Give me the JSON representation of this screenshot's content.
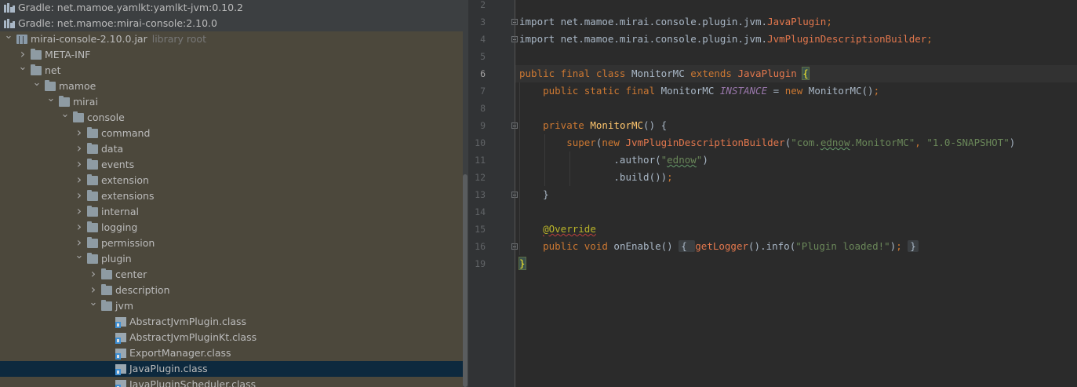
{
  "project_tree": {
    "rows": [
      {
        "label": "Gradle: net.mamoe.yamlkt:yamlkt-jvm:0.10.2",
        "kind": "library",
        "depth": 0,
        "arrow": ""
      },
      {
        "label": "Gradle: net.mamoe:mirai-console:2.10.0",
        "kind": "library",
        "depth": 0,
        "arrow": ""
      },
      {
        "label": "mirai-console-2.10.0.jar",
        "hint": "library root",
        "kind": "jar",
        "depth": 0,
        "arrow": "down"
      },
      {
        "label": "META-INF",
        "kind": "folder",
        "depth": 1,
        "arrow": "right"
      },
      {
        "label": "net",
        "kind": "folder",
        "depth": 1,
        "arrow": "down"
      },
      {
        "label": "mamoe",
        "kind": "folder",
        "depth": 2,
        "arrow": "down"
      },
      {
        "label": "mirai",
        "kind": "folder",
        "depth": 3,
        "arrow": "down"
      },
      {
        "label": "console",
        "kind": "folder",
        "depth": 4,
        "arrow": "down"
      },
      {
        "label": "command",
        "kind": "folder",
        "depth": 5,
        "arrow": "right"
      },
      {
        "label": "data",
        "kind": "folder",
        "depth": 5,
        "arrow": "right"
      },
      {
        "label": "events",
        "kind": "folder",
        "depth": 5,
        "arrow": "right"
      },
      {
        "label": "extension",
        "kind": "folder",
        "depth": 5,
        "arrow": "right"
      },
      {
        "label": "extensions",
        "kind": "folder",
        "depth": 5,
        "arrow": "right"
      },
      {
        "label": "internal",
        "kind": "folder",
        "depth": 5,
        "arrow": "right"
      },
      {
        "label": "logging",
        "kind": "folder",
        "depth": 5,
        "arrow": "right"
      },
      {
        "label": "permission",
        "kind": "folder",
        "depth": 5,
        "arrow": "right"
      },
      {
        "label": "plugin",
        "kind": "folder",
        "depth": 5,
        "arrow": "down"
      },
      {
        "label": "center",
        "kind": "folder",
        "depth": 6,
        "arrow": "right"
      },
      {
        "label": "description",
        "kind": "folder",
        "depth": 6,
        "arrow": "right"
      },
      {
        "label": "jvm",
        "kind": "folder",
        "depth": 6,
        "arrow": "down"
      },
      {
        "label": "AbstractJvmPlugin.class",
        "kind": "class",
        "depth": 7,
        "arrow": ""
      },
      {
        "label": "AbstractJvmPluginKt.class",
        "kind": "class",
        "depth": 7,
        "arrow": ""
      },
      {
        "label": "ExportManager.class",
        "kind": "class",
        "depth": 7,
        "arrow": ""
      },
      {
        "label": "JavaPlugin.class",
        "kind": "class",
        "depth": 7,
        "arrow": "",
        "selected": true
      },
      {
        "label": "JavaPluginScheduler.class",
        "kind": "class",
        "depth": 7,
        "arrow": ""
      }
    ]
  },
  "editor": {
    "lines": [
      {
        "num": "2",
        "tokens": []
      },
      {
        "num": "3",
        "fold": true,
        "tokens": [
          {
            "t": "import net.mamoe.mirai.console.plugin.jvm.",
            "c": "imp"
          },
          {
            "t": "JavaPlugin",
            "c": "iface"
          },
          {
            "t": ";",
            "c": "kw"
          }
        ]
      },
      {
        "num": "4",
        "fold": true,
        "tokens": [
          {
            "t": "import net.mamoe.mirai.console.plugin.jvm.",
            "c": "imp"
          },
          {
            "t": "JvmPluginDescriptionBuilder",
            "c": "iface"
          },
          {
            "t": ";",
            "c": "kw"
          }
        ]
      },
      {
        "num": "5",
        "tokens": []
      },
      {
        "num": "6",
        "current": true,
        "tokens": [
          {
            "t": "public final class ",
            "c": "kw"
          },
          {
            "t": "MonitorMC ",
            "c": "cls"
          },
          {
            "t": "extends ",
            "c": "kw"
          },
          {
            "t": "JavaPlugin ",
            "c": "iface"
          },
          {
            "t": "{",
            "c": "caret-brace brace-match"
          }
        ]
      },
      {
        "num": "7",
        "tokens": [
          {
            "t": "    public static final ",
            "c": "kw"
          },
          {
            "t": "MonitorMC ",
            "c": "cls"
          },
          {
            "t": "INSTANCE",
            "c": "static"
          },
          {
            "t": " = ",
            "c": "cls"
          },
          {
            "t": "new ",
            "c": "kw"
          },
          {
            "t": "MonitorMC()",
            "c": "cls"
          },
          {
            "t": ";",
            "c": "kw"
          }
        ]
      },
      {
        "num": "8",
        "tokens": []
      },
      {
        "num": "9",
        "fold": true,
        "tokens": [
          {
            "t": "    private ",
            "c": "kw"
          },
          {
            "t": "MonitorMC",
            "c": "fn"
          },
          {
            "t": "() {",
            "c": "cls"
          }
        ]
      },
      {
        "num": "10",
        "tokens": [
          {
            "t": "        super",
            "c": "kw"
          },
          {
            "t": "(",
            "c": "cls"
          },
          {
            "t": "new ",
            "c": "kw"
          },
          {
            "t": "JvmPluginDescriptionBuilder",
            "c": "iface"
          },
          {
            "t": "(",
            "c": "cls"
          },
          {
            "t": "\"com.",
            "c": "str"
          },
          {
            "t": "ednow",
            "c": "str typo"
          },
          {
            "t": ".MonitorMC\"",
            "c": "str"
          },
          {
            "t": ", ",
            "c": "kw"
          },
          {
            "t": "\"1.0-SNAPSHOT\"",
            "c": "str"
          },
          {
            "t": ")",
            "c": "cls"
          }
        ]
      },
      {
        "num": "11",
        "tokens": [
          {
            "t": "                .author(",
            "c": "cls"
          },
          {
            "t": "\"",
            "c": "str"
          },
          {
            "t": "ednow",
            "c": "str typo"
          },
          {
            "t": "\"",
            "c": "str"
          },
          {
            "t": ")",
            "c": "cls"
          }
        ]
      },
      {
        "num": "12",
        "tokens": [
          {
            "t": "                .build())",
            "c": "cls"
          },
          {
            "t": ";",
            "c": "kw"
          }
        ]
      },
      {
        "num": "13",
        "fold": true,
        "tokens": [
          {
            "t": "    }",
            "c": "cls"
          }
        ]
      },
      {
        "num": "14",
        "tokens": []
      },
      {
        "num": "15",
        "tokens": [
          {
            "t": "    ",
            "c": "cls"
          },
          {
            "t": "@Override",
            "c": "anno warn-under"
          }
        ]
      },
      {
        "num": "16",
        "fold": true,
        "tokens": [
          {
            "t": "    public void ",
            "c": "kw"
          },
          {
            "t": "onEnable",
            "c": "cls"
          },
          {
            "t": "() ",
            "c": "cls"
          },
          {
            "t": "{ ",
            "c": "fold"
          },
          {
            "t": "getLogger",
            "c": "iface"
          },
          {
            "t": "().info(",
            "c": "cls"
          },
          {
            "t": "\"Plugin loaded!\"",
            "c": "str"
          },
          {
            "t": ")",
            "c": "cls"
          },
          {
            "t": "; ",
            "c": "kw"
          },
          {
            "t": "}",
            "c": "fold"
          }
        ]
      },
      {
        "num": "19",
        "tokens": [
          {
            "t": "}",
            "c": "caret-brace brace-match"
          }
        ]
      }
    ]
  },
  "colors": {
    "tree_bg": "#3c3f41",
    "tree_dim_bg": "#4c483c",
    "selection": "#0d293e",
    "editor_bg": "#2b2b2b",
    "gutter_bg": "#313335",
    "keyword": "#cc7832",
    "string": "#6a8759",
    "function": "#ffc66d",
    "annotation": "#bbb529"
  }
}
